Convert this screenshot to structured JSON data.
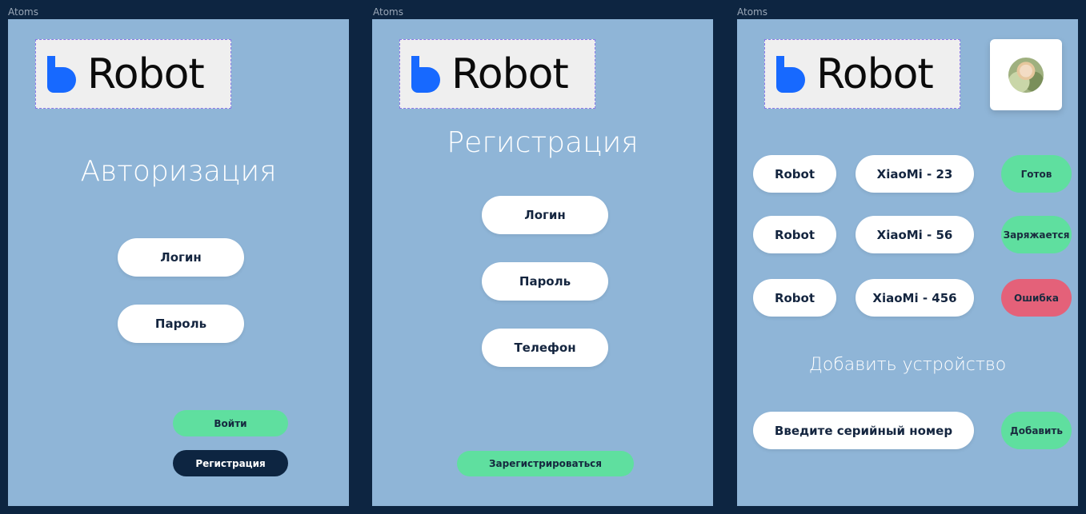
{
  "frames": [
    {
      "label": "Atoms",
      "logo_text": "Robot",
      "heading": "Авторизация",
      "login_field": "Логин",
      "password_field": "Пароль",
      "login_button": "Войти",
      "register_button": "Регистрация"
    },
    {
      "label": "Atoms",
      "logo_text": "Robot",
      "heading": "Регистрация",
      "login_field": "Логин",
      "password_field": "Пароль",
      "phone_field": "Телефон",
      "submit_button": "Зарегистрироваться"
    },
    {
      "label": "Atoms",
      "logo_text": "Robot",
      "devices": [
        {
          "name": "Robot",
          "model": "XiaoMi - 23",
          "status": "Готов",
          "status_color": "#5fdf9f"
        },
        {
          "name": "Robot",
          "model": "XiaoMi - 56",
          "status": "Заряжается",
          "status_color": "#5fdf9f"
        },
        {
          "name": "Robot",
          "model": "XiaoMi - 456",
          "status": "Ошибка",
          "status_color": "#e46179"
        }
      ],
      "add_heading": "Добавить устройство",
      "serial_input": "Введите серийный номер",
      "add_button": "Добавить"
    }
  ],
  "colors": {
    "background": "#0d2541",
    "frame": "#8fb5d7",
    "accent_green": "#5fdf9f",
    "error_red": "#e46179",
    "logo_blue": "#1769ff"
  }
}
